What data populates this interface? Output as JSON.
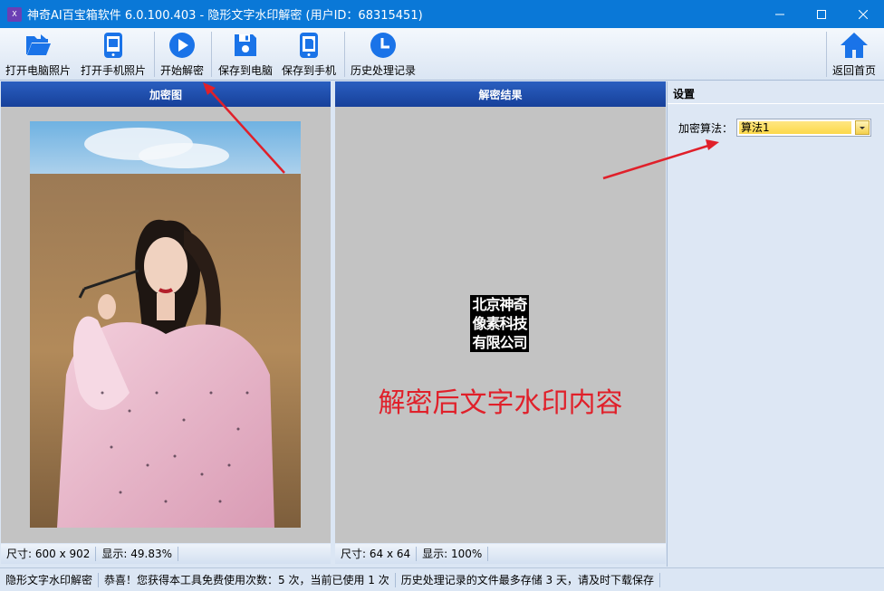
{
  "window": {
    "icon_text": "X",
    "title": "神奇AI百宝箱软件 6.0.100.403 - 隐形文字水印解密 (用户ID：68315451)"
  },
  "toolbar": {
    "open_pc_photo": "打开电脑照片",
    "open_phone_photo": "打开手机照片",
    "start_decrypt": "开始解密",
    "save_to_pc": "保存到电脑",
    "save_to_phone": "保存到手机",
    "history": "历史处理记录",
    "back_home": "返回首页"
  },
  "left_panel": {
    "title": "加密图",
    "size": "尺寸: 600 x 902",
    "display": "显示: 49.83%"
  },
  "mid_panel": {
    "title": "解密结果",
    "watermark_lines": [
      "北京神奇",
      "像素科技",
      "有限公司"
    ],
    "caption": "解密后文字水印内容",
    "size": "尺寸: 64 x 64",
    "display": "显示: 100%"
  },
  "settings": {
    "title": "设置",
    "algo_label": "加密算法：",
    "algo_value": "算法1"
  },
  "statusbar": {
    "module": "隐形文字水印解密",
    "usage": "恭喜！您获得本工具免费使用次数：5 次，当前已使用 1 次",
    "history_note": "历史处理记录的文件最多存储 3 天，请及时下载保存"
  },
  "colors": {
    "titlebar": "#0a78d7",
    "panel_header": "#1c4aa8",
    "accent_red": "#e0202a",
    "icon_blue": "#1a73e8"
  }
}
